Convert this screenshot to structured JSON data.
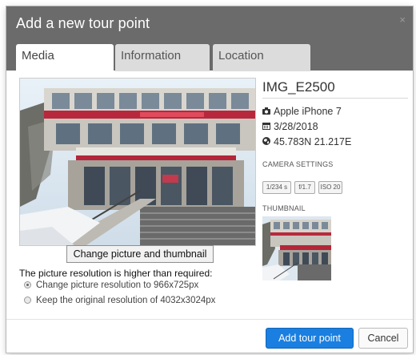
{
  "dialog": {
    "title": "Add a new tour point",
    "close_glyph": "×"
  },
  "tabs": [
    {
      "label": "Media",
      "active": true
    },
    {
      "label": "Information",
      "active": false
    },
    {
      "label": "Location",
      "active": false
    }
  ],
  "media": {
    "change_button": "Change picture and thumbnail",
    "resolution_message": "The picture resolution is higher than required:",
    "options": [
      {
        "label": "Change picture resolution to 966x725px",
        "checked": true
      },
      {
        "label": "Keep the original resolution of 4032x3024px",
        "checked": false
      }
    ]
  },
  "details": {
    "name": "IMG_E2500",
    "camera": "Apple iPhone 7",
    "date": "3/28/2018",
    "coordinates": "45.783N 21.217E",
    "camera_settings_label": "CAMERA SETTINGS",
    "settings": [
      "1/234 s",
      "f/1.7",
      "ISO 20"
    ],
    "thumbnail_label": "THUMBNAIL"
  },
  "icons": {
    "camera": "camera-icon",
    "calendar": "calendar-icon",
    "location": "globe-icon"
  },
  "footer": {
    "add_label": "Add tour point",
    "cancel_label": "Cancel"
  },
  "colors": {
    "header": "#6b6b6b",
    "primary": "#1a7fe0"
  }
}
